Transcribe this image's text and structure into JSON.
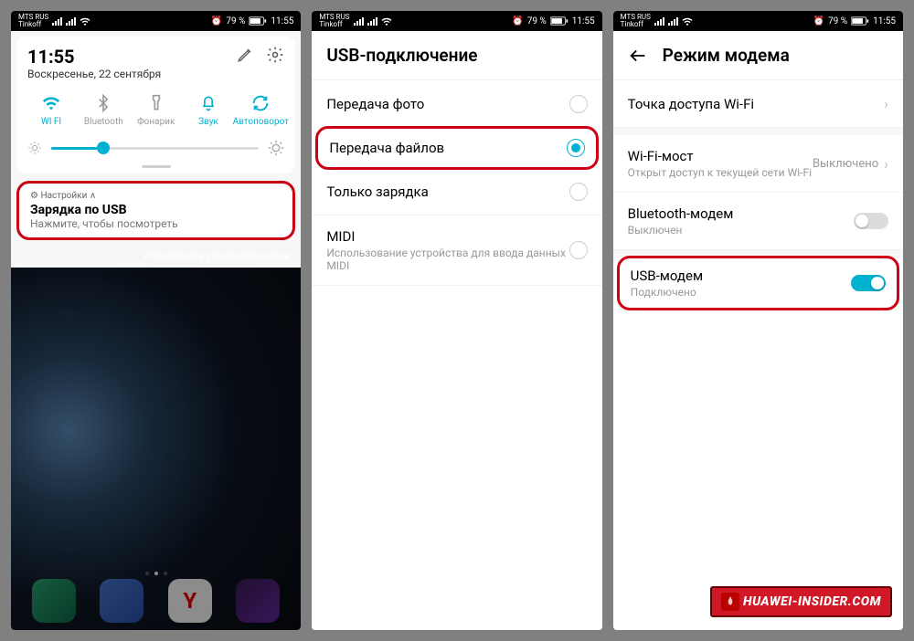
{
  "status": {
    "carrier1": "MTS RUS",
    "carrier2": "Tinkoff",
    "battery": "79 %",
    "time": "11:55",
    "alarm": "⏰"
  },
  "p1": {
    "time": "11:55",
    "date": "Воскресенье, 22 сентября",
    "toggles": [
      {
        "label": "WI FI",
        "icon": "wifi",
        "active": true
      },
      {
        "label": "Bluetooth",
        "icon": "bt",
        "active": false
      },
      {
        "label": "Фонарик",
        "icon": "torch",
        "active": false
      },
      {
        "label": "Звук",
        "icon": "bell",
        "active": true
      },
      {
        "label": "Автоповорот",
        "icon": "rotate",
        "active": true
      }
    ],
    "notif": {
      "app": "Настройки ∧",
      "title": "Зарядка по USB",
      "sub": "Нажмите, чтобы посмотреть"
    },
    "manage": "Управление уведомлениями"
  },
  "p2": {
    "title": "USB-подключение",
    "items": [
      {
        "title": "Передача фото",
        "sel": false
      },
      {
        "title": "Передача файлов",
        "sel": true,
        "hl": true
      },
      {
        "title": "Только зарядка",
        "sel": false
      },
      {
        "title": "MIDI",
        "sub": "Использование устройства для ввода данных MIDI",
        "sel": false
      }
    ]
  },
  "p3": {
    "title": "Режим модема",
    "items": [
      {
        "title": "Точка доступа Wi-Fi",
        "type": "nav"
      },
      {
        "title": "Wi-Fi-мост",
        "sub": "Открыт доступ к текущей сети Wi-Fi",
        "type": "nav",
        "value": "Выключено"
      },
      {
        "title": "Bluetooth-модем",
        "sub": "Выключен",
        "type": "toggle",
        "on": false
      },
      {
        "title": "USB-модем",
        "sub": "Подключено",
        "type": "toggle",
        "on": true,
        "hl": true
      }
    ]
  },
  "badge": "HUAWEI-INSIDER.COM"
}
